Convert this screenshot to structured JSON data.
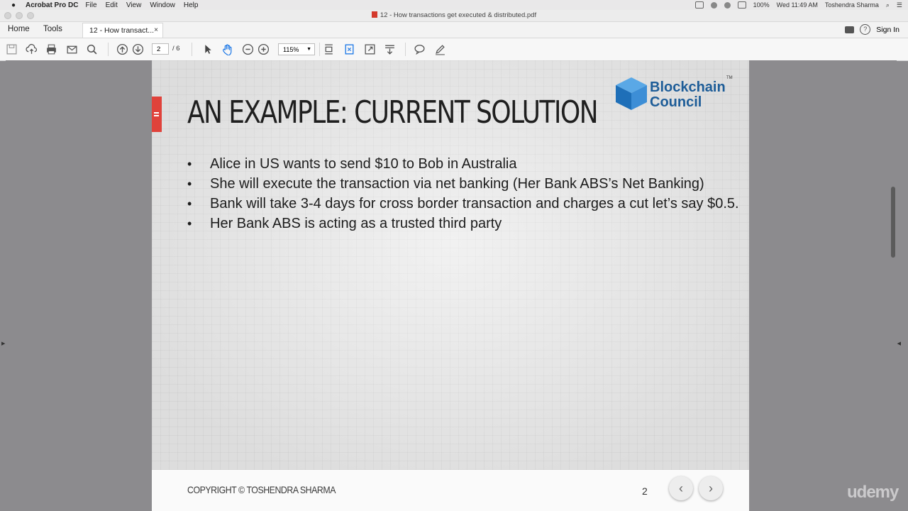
{
  "menubar": {
    "app_name": "Acrobat Pro DC",
    "items": [
      "File",
      "Edit",
      "View",
      "Window",
      "Help"
    ],
    "battery": "100%",
    "clock": "Wed 11:49 AM",
    "user": "Toshendra Sharma"
  },
  "window": {
    "title": "12 - How transactions get executed & distributed.pdf"
  },
  "tabbar": {
    "home": "Home",
    "tools": "Tools",
    "doc_tab": "12 - How transact...",
    "close": "×",
    "sign_in": "Sign In",
    "help": "?"
  },
  "toolbar": {
    "page_current": "2",
    "page_total": "/ 6",
    "zoom": "115%"
  },
  "slide": {
    "title": "AN EXAMPLE: CURRENT SOLUTION",
    "logo_line1": "Blockchain",
    "logo_line2": "Council",
    "logo_tm": "TM",
    "bullets": [
      "Alice in US wants to send $10 to Bob in Australia",
      "She will execute the transaction via net banking (Her Bank ABS’s Net Banking)",
      "Bank will take 3-4 days for cross border transaction and charges a cut let’s say $0.5.",
      "Her Bank ABS is acting as a trusted third party"
    ],
    "copyright": "COPYRIGHT © TOSHENDRA SHARMA",
    "page_number": "2",
    "prev": "‹",
    "next": "›"
  },
  "watermark": "udemy",
  "colors": {
    "accent_red": "#e0423b",
    "logo_blue": "#1e5d98",
    "tool_blue": "#1473e6"
  }
}
